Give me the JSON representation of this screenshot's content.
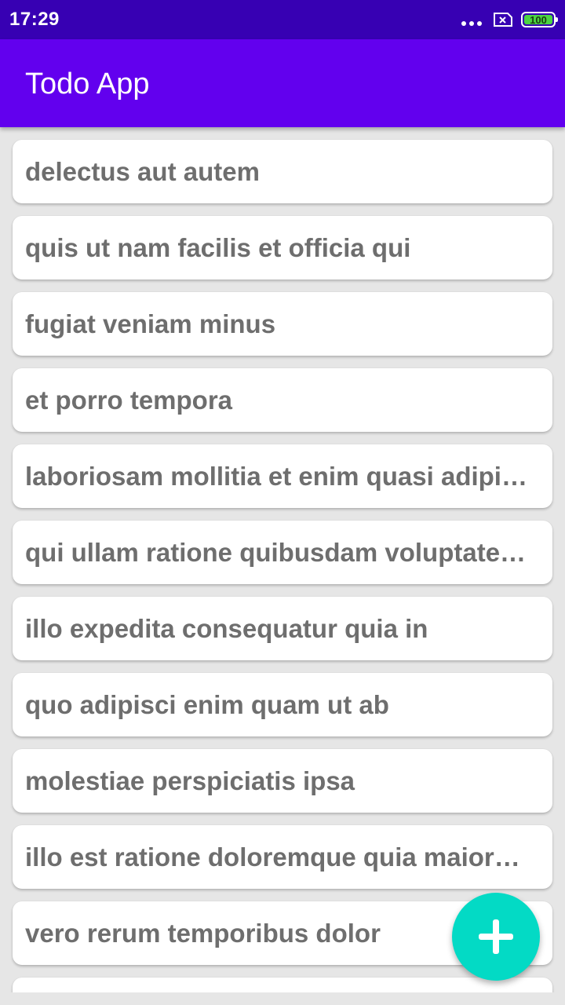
{
  "status_bar": {
    "time": "17:29",
    "icons": [
      "more-dots-icon",
      "sim-card-x-icon",
      "battery-icon"
    ],
    "battery_level": "100",
    "battery_color": "#4cd442"
  },
  "app_bar": {
    "title": "Todo App",
    "color": "#6200ee",
    "status_color": "#3700b3"
  },
  "todos": [
    "delectus aut autem",
    "quis ut nam facilis et officia qui",
    "fugiat veniam minus",
    "et porro tempora",
    "laboriosam mollitia et enim quasi adipi…",
    "qui ullam ratione quibusdam voluptate…",
    "illo expedita consequatur quia in",
    "quo adipisci enim quam ut ab",
    "molestiae perspiciatis ipsa",
    "illo est ratione doloremque quia maior…",
    "vero rerum temporibus dolor",
    ""
  ],
  "fab": {
    "icon": "plus-icon",
    "color": "#03dac5"
  }
}
